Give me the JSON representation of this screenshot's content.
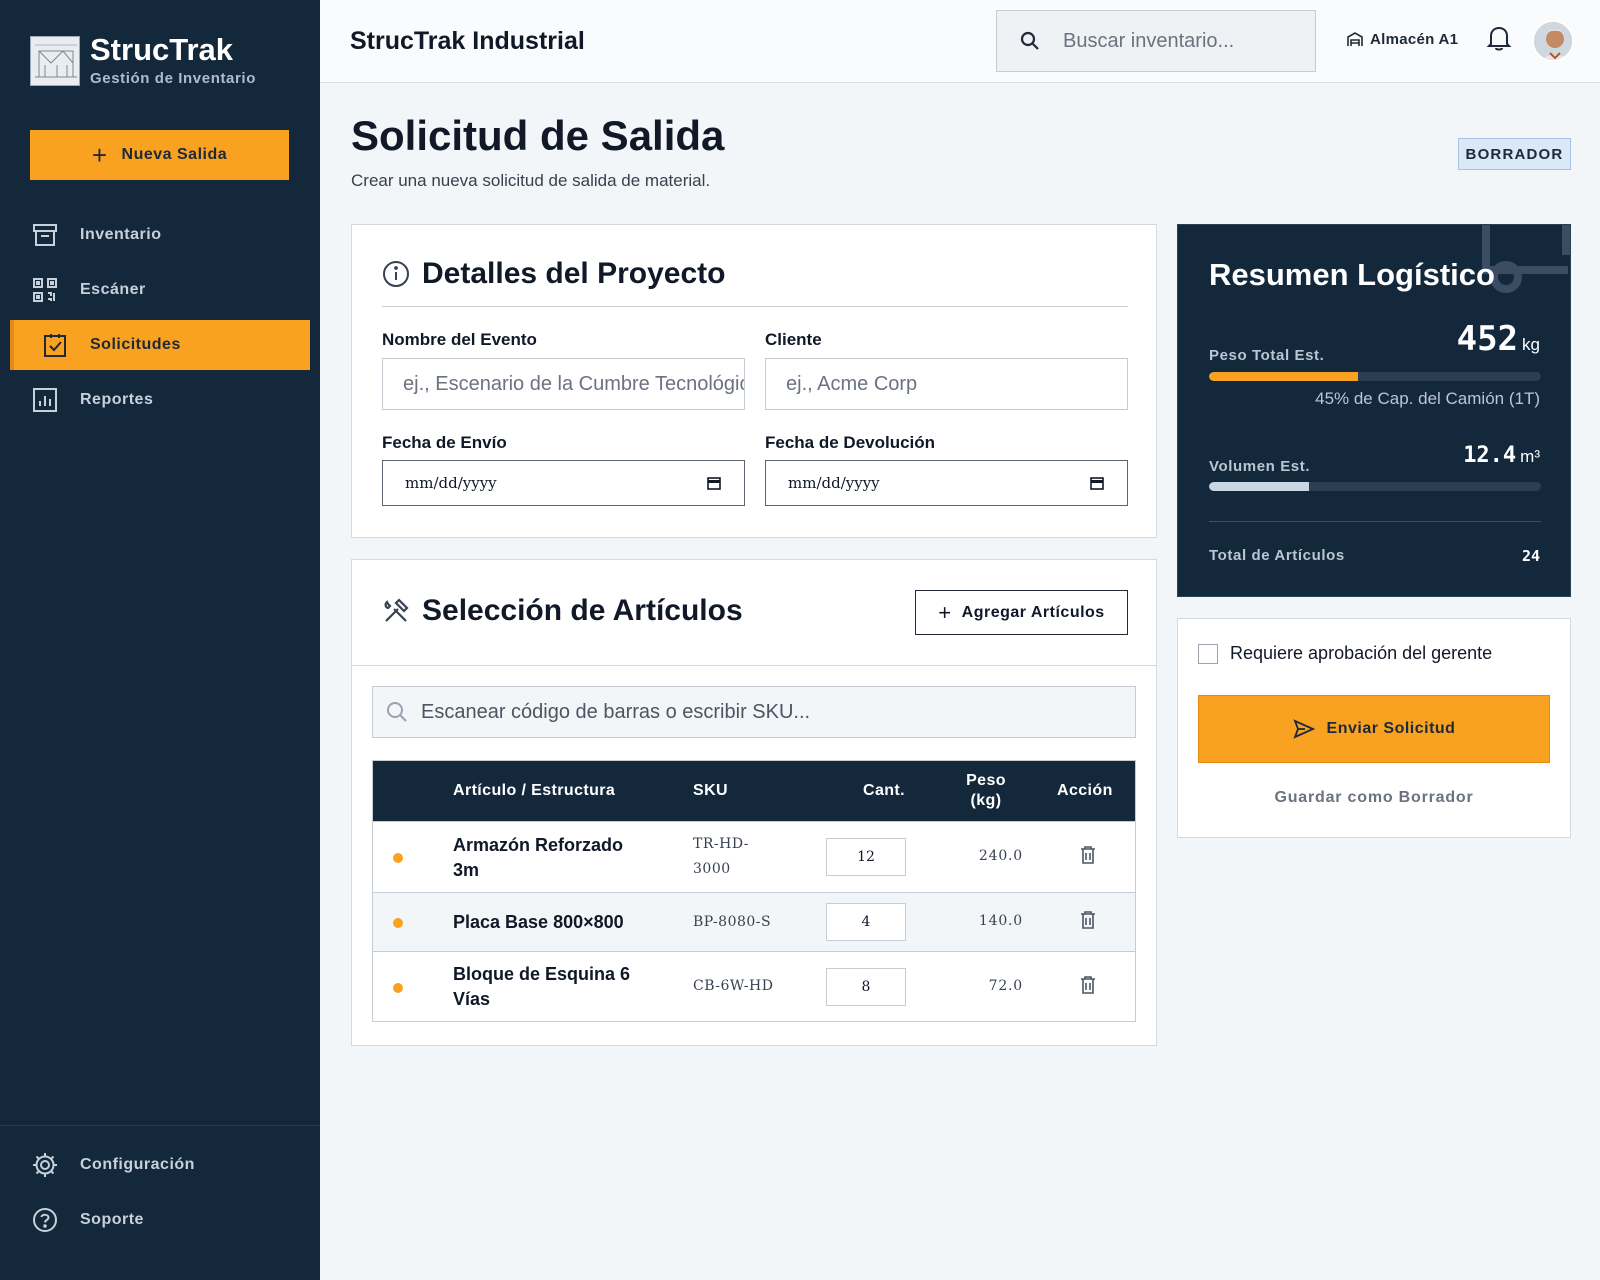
{
  "brand": {
    "name": "StrucTrak",
    "subtitle": "Gestión de Inventario"
  },
  "sidebar": {
    "new_button_label": "Nueva Salida",
    "items": [
      {
        "label": "Inventario",
        "icon": "archive-icon",
        "active": false
      },
      {
        "label": "Escáner",
        "icon": "qr-code-icon",
        "active": false
      },
      {
        "label": "Solicitudes",
        "icon": "clipboard-check-icon",
        "active": true
      },
      {
        "label": "Reportes",
        "icon": "bar-chart-icon",
        "active": false
      }
    ],
    "bottom_items": [
      {
        "label": "Configuración",
        "icon": "gear-icon"
      },
      {
        "label": "Soporte",
        "icon": "help-circle-icon"
      }
    ]
  },
  "header": {
    "title": "StrucTrak Industrial",
    "search_placeholder": "Buscar inventario...",
    "warehouse_label": "Almacén A1"
  },
  "page": {
    "title": "Solicitud de Salida",
    "subtitle": "Crear una nueva solicitud de salida de material.",
    "status": "BORRADOR"
  },
  "project": {
    "title": "Detalles del Proyecto",
    "event_label": "Nombre del Evento",
    "event_placeholder": "ej., Escenario de la Cumbre Tecnológica",
    "client_label": "Cliente",
    "client_placeholder": "ej., Acme Corp",
    "ship_label": "Fecha de Envío",
    "ship_placeholder": "mm/dd/yyyy",
    "return_label": "Fecha de Devolución",
    "return_placeholder": "mm/dd/yyyy"
  },
  "items": {
    "title": "Selección de Artículos",
    "add_button_label": "Agregar Artículos",
    "scan_placeholder": "Escanear código de barras o escribir SKU...",
    "columns": {
      "name": "Artículo / Estructura",
      "sku": "SKU",
      "qty": "Cant.",
      "weight": "Peso (kg)",
      "action": "Acción"
    },
    "rows": [
      {
        "name": "Armazón Reforzado 3m",
        "sku": "TR-HD-3000",
        "qty": "12",
        "weight": "240.0"
      },
      {
        "name": "Placa Base 800×800",
        "sku": "BP-8080-S",
        "qty": "4",
        "weight": "140.0"
      },
      {
        "name": "Bloque de Esquina 6 Vías",
        "sku": "CB-6W-HD",
        "qty": "8",
        "weight": "72.0"
      }
    ]
  },
  "summary": {
    "title": "Resumen Logístico",
    "weight_label": "Peso Total Est.",
    "weight_value": "452",
    "weight_unit": "kg",
    "weight_fraction": 0.45,
    "capacity_note": "45% de Cap. del Camión (1T)",
    "volume_label": "Volumen Est.",
    "volume_value": "12.4",
    "volume_unit": "m³",
    "volume_fraction": 0.3,
    "total_items_label": "Total de Artículos",
    "total_items_value": "24"
  },
  "actions": {
    "approval_label": "Requiere aprobación del gerente",
    "submit_label": "Enviar Solicitud",
    "draft_label": "Guardar como Borrador"
  },
  "colors": {
    "accent": "#f9a221",
    "sidebar": "#14283c",
    "volume_bar": "#c9d6e4"
  }
}
